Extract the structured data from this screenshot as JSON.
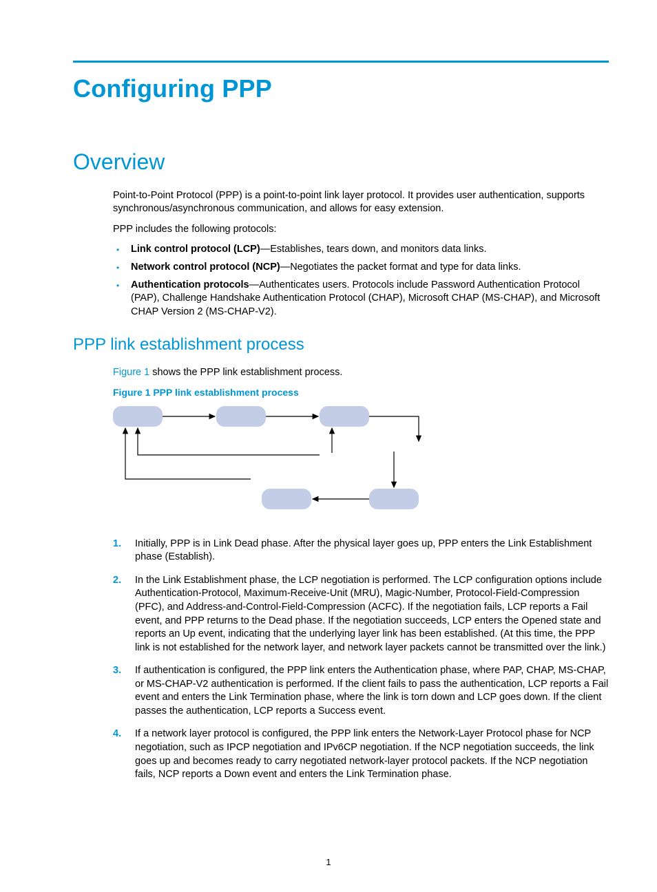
{
  "title": "Configuring PPP",
  "sections": {
    "overview": {
      "heading": "Overview",
      "p1": "Point-to-Point Protocol (PPP) is a point-to-point link layer protocol. It provides user authentication, supports synchronous/asynchronous communication, and allows for easy extension.",
      "p2": "PPP includes the following protocols:",
      "bullets": [
        {
          "bold": "Link control protocol (LCP)",
          "rest": "—Establishes, tears down, and monitors data links."
        },
        {
          "bold": "Network control protocol (NCP)",
          "rest": "—Negotiates the packet format and type for data links."
        },
        {
          "bold": "Authentication protocols",
          "rest": "—Authenticates users. Protocols include Password Authentication Protocol (PAP), Challenge Handshake Authentication Protocol (CHAP), Microsoft CHAP (MS-CHAP), and Microsoft CHAP Version 2 (MS-CHAP-V2)."
        }
      ]
    },
    "link_process": {
      "heading": "PPP link establishment process",
      "intro_ref": "Figure 1",
      "intro_rest": " shows the PPP link establishment process.",
      "figcap": "Figure 1 PPP link establishment process",
      "steps": [
        "Initially, PPP is in Link Dead phase. After the physical layer goes up, PPP enters the Link Establishment phase (Establish).",
        "In the Link Establishment phase, the LCP negotiation is performed. The LCP configuration options include Authentication-Protocol, Maximum-Receive-Unit (MRU), Magic-Number, Protocol-Field-Compression (PFC), and Address-and-Control-Field-Compression (ACFC). If the negotiation fails, LCP reports a Fail event, and PPP returns to the Dead phase. If the negotiation succeeds, LCP enters the Opened state and reports an Up event, indicating that the underlying layer link has been established. (At this time, the PPP link is not established for the network layer, and network layer packets cannot be transmitted over the link.)",
        "If authentication is configured, the PPP link enters the Authentication phase, where PAP, CHAP, MS-CHAP, or MS-CHAP-V2 authentication is performed. If the client fails to pass the authentication, LCP reports a Fail event and enters the Link Termination phase, where the link is torn down and LCP goes down. If the client passes the authentication, LCP reports a Success event.",
        "If a network layer protocol is configured, the PPP link enters the Network-Layer Protocol phase for NCP negotiation, such as IPCP negotiation and IPv6CP negotiation. If the NCP negotiation succeeds, the link goes up and becomes ready to carry negotiated network-layer protocol packets. If the NCP negotiation fails, NCP reports a Down event and enters the Link Termination phase."
      ]
    }
  },
  "pagenum": "1"
}
